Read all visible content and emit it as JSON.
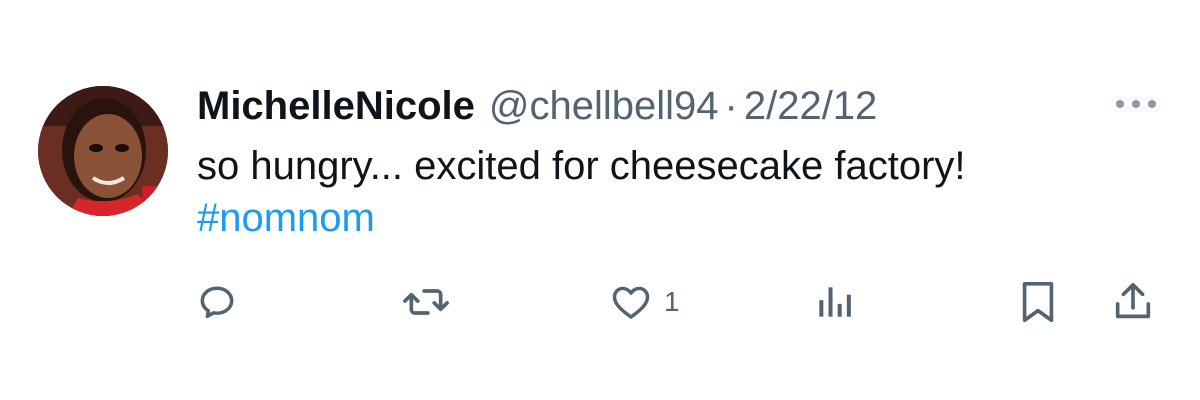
{
  "tweet": {
    "author": {
      "display_name": "MichelleNicole",
      "handle": "@chellbell94"
    },
    "separator": "·",
    "date": "2/22/12",
    "text": "so hungry... excited for cheesecake factory!",
    "hashtag": "#nomnom"
  },
  "actions": {
    "reply_icon": "reply-icon",
    "retweet_icon": "retweet-icon",
    "like_icon": "heart-icon",
    "like_count": "1",
    "views_icon": "views-icon",
    "bookmark_icon": "bookmark-icon",
    "share_icon": "share-icon"
  },
  "colors": {
    "text_primary": "#0f1419",
    "text_secondary": "#536471",
    "link": "#1d9bf0",
    "more_dots": "#8b98a5"
  }
}
